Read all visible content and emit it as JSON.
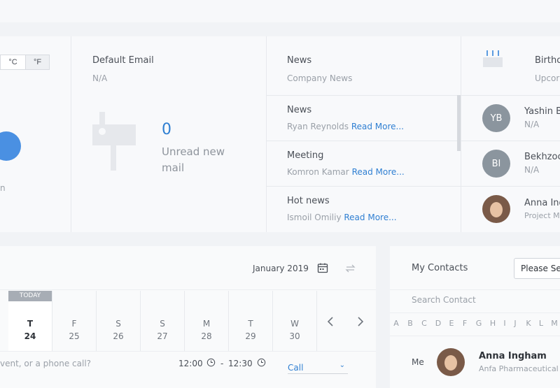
{
  "weather": {
    "unit_c": "°C",
    "unit_f": "°F",
    "partial_text": "n"
  },
  "email": {
    "title": "Default Email",
    "address": "N/A",
    "unread_count": "0",
    "unread_label_1": "Unread new",
    "unread_label_2": "mail"
  },
  "news": {
    "title": "News",
    "subtitle": "Company News",
    "read_more": "Read More...",
    "items": [
      {
        "title": "News",
        "author": "Ryan Reynolds"
      },
      {
        "title": "Meeting",
        "author": "Komron Kamar"
      },
      {
        "title": "Hot news",
        "author": "Ismoil Omiliy"
      }
    ]
  },
  "birthdays": {
    "title": "Birtho",
    "subtitle": "Upcor",
    "people": [
      {
        "initials": "YB",
        "name": "Yashin B",
        "detail": "N/A"
      },
      {
        "initials": "BI",
        "name": "Bekhzoc",
        "detail": "N/A"
      },
      {
        "initials": "",
        "name": "Anna Ing",
        "detail": "Project M"
      }
    ]
  },
  "calendar": {
    "month": "January 2019",
    "today_badge": "TODAY",
    "days": [
      {
        "name": "T",
        "num": "24"
      },
      {
        "name": "F",
        "num": "25"
      },
      {
        "name": "S",
        "num": "26"
      },
      {
        "name": "S",
        "num": "27"
      },
      {
        "name": "M",
        "num": "28"
      },
      {
        "name": "T",
        "num": "29"
      },
      {
        "name": "W",
        "num": "30"
      }
    ],
    "event_placeholder": "vent, or a phone call?",
    "time_from": "12:00",
    "time_sep": "-",
    "time_to": "12:30",
    "type": "Call"
  },
  "contacts": {
    "title": "My Contacts",
    "select_placeholder": "Please Se",
    "search_placeholder": "Search Contact",
    "letters": [
      "A",
      "B",
      "C",
      "D",
      "E",
      "F",
      "G",
      "H",
      "I",
      "J",
      "K",
      "L",
      "M"
    ],
    "me_label": "Me",
    "me_name": "Anna Ingham",
    "me_company": "Anfa Pharmaceutical"
  }
}
